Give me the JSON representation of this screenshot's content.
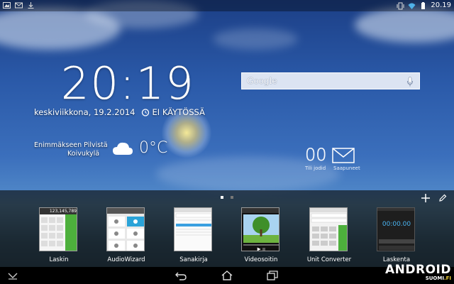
{
  "status_bar": {
    "time": "20.19",
    "left_icons": [
      "image-icon",
      "gmail-icon",
      "download-icon"
    ],
    "right_icons": [
      "vibrate-icon",
      "wifi-icon",
      "battery-icon"
    ]
  },
  "clock": {
    "time": "20:19",
    "date": "keskiviikkona, 19.2.2014",
    "alarm": "EI KÄYTÖSSÄ"
  },
  "weather": {
    "condition": "Enimmäkseen Pilvistä",
    "city": "Koivukylä",
    "temperature": "0°C"
  },
  "search": {
    "logo": "Google"
  },
  "email_widget": {
    "count": "00",
    "label_unread": "Tili jodid",
    "label_inbox": "Saapuneet"
  },
  "dock": {
    "page_dots": 2,
    "active_dot": 0,
    "apps": [
      {
        "label": "Laskin"
      },
      {
        "label": "AudioWizard"
      },
      {
        "label": "Sanakirja"
      },
      {
        "label": "Videosoitin"
      },
      {
        "label": "Unit Converter"
      },
      {
        "label": "Laskenta"
      }
    ],
    "calc_display": "123,145,789",
    "timer_display": "00:00.00"
  },
  "branding": {
    "main": "ANDROID",
    "sub_prefix": "SUOMI",
    "sub_suffix": ".FI"
  },
  "colors": {
    "calc_green": "#4db03c",
    "timer_blue": "#4ab3f0",
    "brand_yellow": "#f3d43c"
  }
}
